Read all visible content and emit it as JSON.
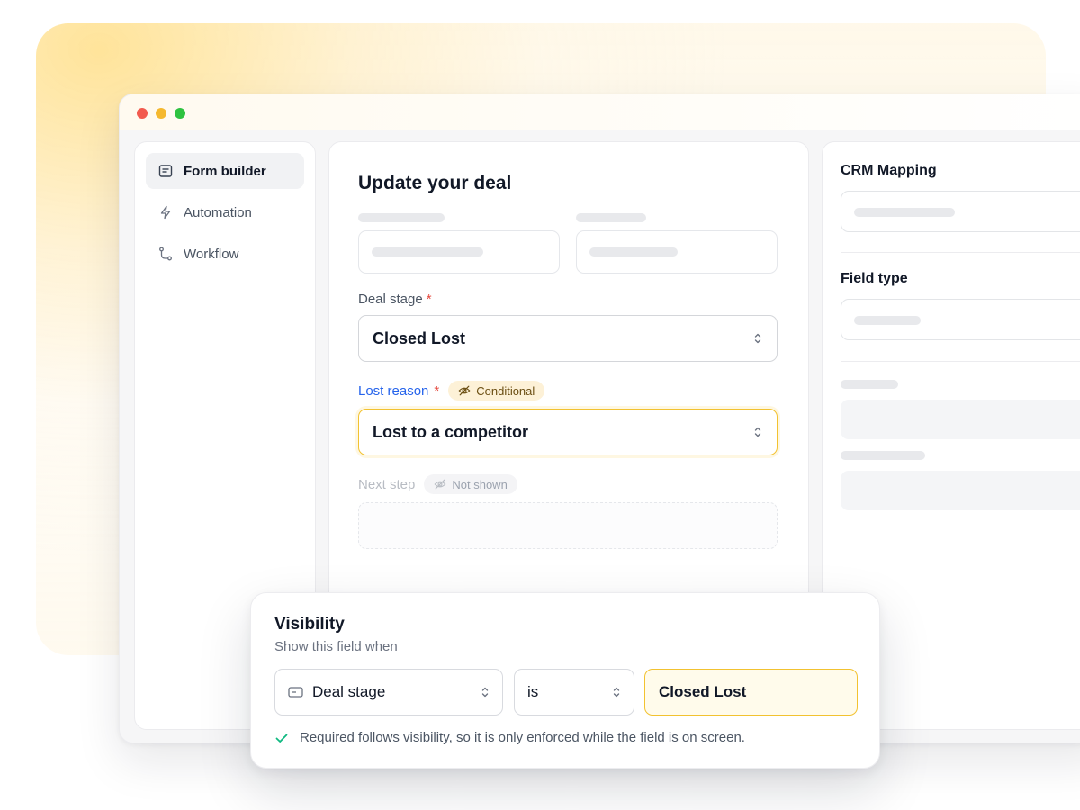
{
  "sidebar": {
    "items": [
      {
        "label": "Form builder",
        "icon": "form-icon",
        "active": true
      },
      {
        "label": "Automation",
        "icon": "lightning-icon",
        "active": false
      },
      {
        "label": "Workflow",
        "icon": "workflow-icon",
        "active": false
      }
    ]
  },
  "form": {
    "title": "Update your deal",
    "deal_stage": {
      "label": "Deal stage",
      "required_mark": "*",
      "value": "Closed Lost"
    },
    "lost_reason": {
      "label": "Lost reason",
      "required_mark": "*",
      "badge": "Conditional",
      "value": "Lost to a competitor"
    },
    "next_step": {
      "label": "Next step",
      "badge": "Not shown"
    }
  },
  "right_panel": {
    "crm_mapping_title": "CRM Mapping",
    "field_type_title": "Field type"
  },
  "visibility": {
    "title": "Visibility",
    "subtitle": "Show this field when",
    "field_select": "Deal stage",
    "operator_select": "is",
    "value": "Closed Lost",
    "note": "Required follows visibility, so it is only enforced while the field is on screen."
  },
  "colors": {
    "accent_yellow": "#f2c230",
    "link_blue": "#2563eb",
    "required_red": "#e5483d",
    "success_green": "#10b981"
  }
}
